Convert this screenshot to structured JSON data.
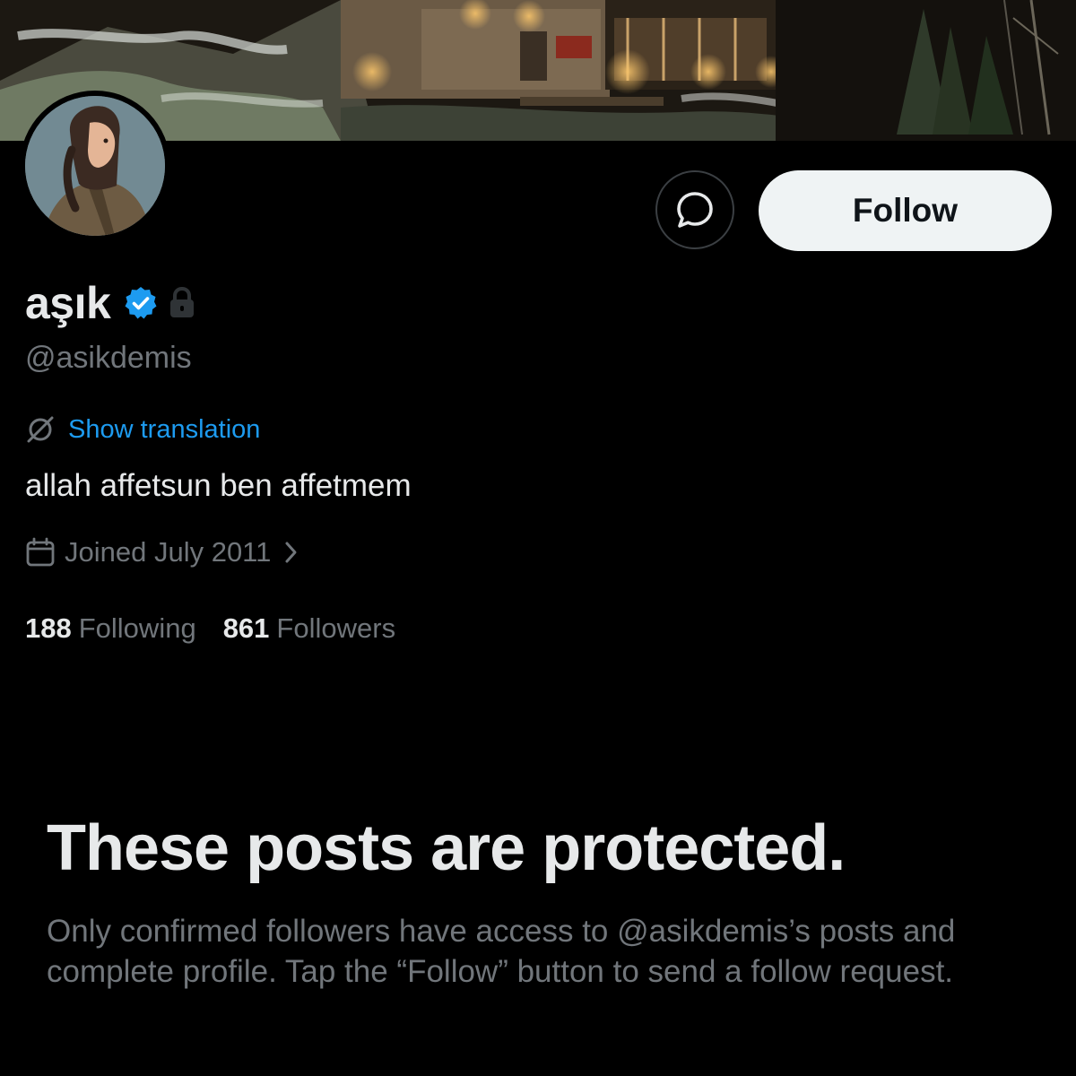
{
  "profile": {
    "display_name": "aşık",
    "handle": "@asikdemis",
    "verified_icon": "verified-badge-icon",
    "lock_icon": "lock-icon",
    "show_translation": "Show translation",
    "bio": "allah affetsun ben affetmem",
    "joined": "Joined July 2011",
    "following_count": "188",
    "following_label": "Following",
    "followers_count": "861",
    "followers_label": "Followers"
  },
  "actions": {
    "message_icon": "message-bubble-icon",
    "follow_label": "Follow"
  },
  "protected": {
    "title": "These posts are protected.",
    "description": "Only confirmed followers have access to @asikdemis’s posts and complete profile. Tap the “Follow” button to send a follow request."
  },
  "colors": {
    "background": "#000000",
    "accent": "#1d9bf0",
    "secondary_text": "#71767b",
    "primary_text": "#e7e9ea",
    "follow_button": "#eff3f4"
  }
}
